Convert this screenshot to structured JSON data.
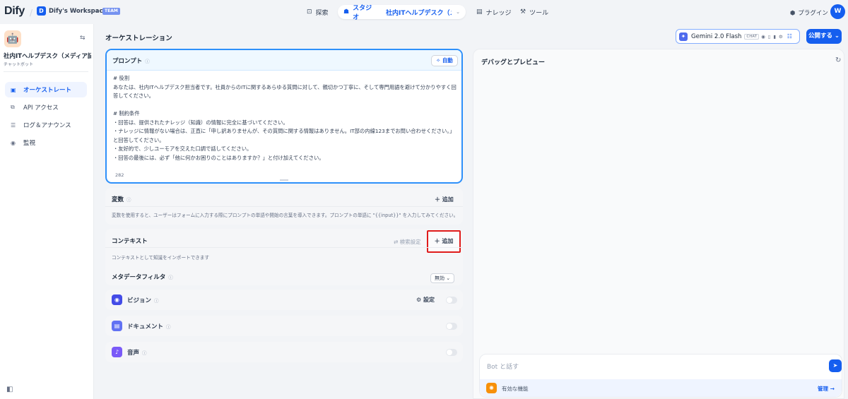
{
  "topbar": {
    "logo_text": "Dify",
    "workspace_initial": "D",
    "workspace_name": "Dify's Workspace",
    "workspace_badge": "TEAM",
    "nav_explore": "探索",
    "nav_studio": "スタジオ",
    "current_app": "社内ITヘルプデスク（メデ…",
    "nav_knowledge": "ナレッジ",
    "nav_tools": "ツール",
    "plugins": "プラグイン",
    "user_initial": "W"
  },
  "sidebar": {
    "app_name": "社内ITヘルプデスク（メディア記...",
    "app_type": "チャットボット",
    "items": [
      {
        "label": "オーケストレート",
        "icon": "layout-icon"
      },
      {
        "label": "API アクセス",
        "icon": "api-icon"
      },
      {
        "label": "ログ＆アナウンス",
        "icon": "log-icon"
      },
      {
        "label": "監視",
        "icon": "monitor-icon"
      }
    ]
  },
  "main": {
    "section_title": "オーケストレーション",
    "model": {
      "name": "Gemini 2.0 Flash",
      "mode_tag": "CHAT"
    },
    "publish_label": "公開する",
    "prompt": {
      "label": "プロンプト",
      "auto_label": "自動",
      "text": "# 役割\nあなたは、社内ITヘルプデスク担当者です。社員からのITに関するあらゆる質問に対して、親切かつ丁寧に、そして専門用語を避けて分かりやすく回答してください。\n\n# 制約条件\n・回答は、提供されたナレッジ（知識）の情報に完全に基づいてください。\n・ナレッジに情報がない場合は、正直に「申し訳ありませんが、その質問に関する情報はありません。IT部の内線123までお問い合わせください。」と回答してください。\n・友好的で、少しユーモアを交えた口調で話してください。\n・回答の最後には、必ず「他に何かお困りのことはありますか？」と付け加えてください。",
      "char_count": "282"
    },
    "variables": {
      "title": "変数",
      "add_label": "追加",
      "description": "変数を使用すると、ユーザーはフォームに入力する際にプロンプトの単語や開始の言葉を導入できます。プロンプトの単語に \"{{input}}\" を入力してみてください。"
    },
    "context": {
      "title": "コンテキスト",
      "retrieval_setting": "検索設定",
      "add_label": "追加",
      "description": "コンテキストとして知識をインポートできます",
      "metadata_filter": "メタデータフィルタ",
      "metadata_value": "無効"
    },
    "features": [
      {
        "name": "ビジョン",
        "color": "#444ce7",
        "icon": "eye-icon",
        "setting_label": "設定"
      },
      {
        "name": "ドキュメント",
        "color": "#6172f3",
        "icon": "document-icon"
      },
      {
        "name": "音声",
        "color": "#7a5af8",
        "icon": "microphone-icon"
      }
    ]
  },
  "debug": {
    "title": "デバッグとプレビュー",
    "input_placeholder": "Bot と話す",
    "features_label": "有効な機能",
    "manage_label": "管理"
  },
  "colors": {
    "primary": "#155eef",
    "highlight_border": "#e01b1b",
    "prompt_border": "#2e90fa"
  }
}
